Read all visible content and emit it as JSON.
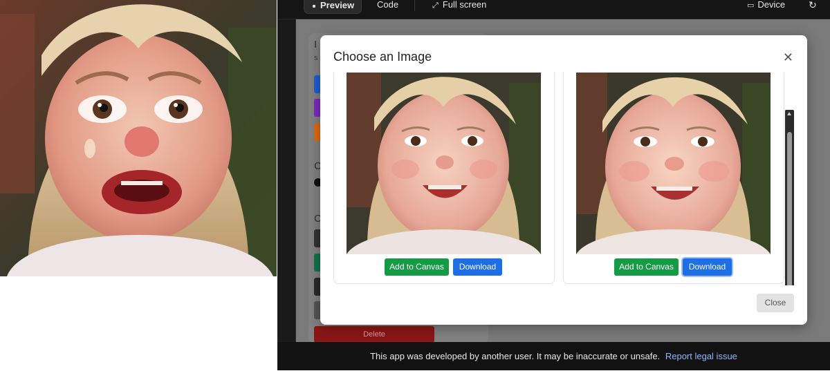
{
  "topbar": {
    "tabs": [
      {
        "label": "Preview",
        "active": true
      },
      {
        "label": "Code",
        "active": false
      },
      {
        "label": "Full screen",
        "icon": "expand-icon"
      }
    ],
    "device_label": "Device",
    "device_icon": "device-icon",
    "reload_icon": "refresh-icon"
  },
  "background": {
    "letters": [
      "I",
      "S",
      "C",
      "C"
    ],
    "chip_colors": [
      "#1e5fd6",
      "#7a2bc2",
      "#e06b14"
    ],
    "delete_label": "Delete"
  },
  "modal": {
    "title": "Choose an Image",
    "close_icon": "close-icon",
    "images": [
      {
        "add_label": "Add to Canvas",
        "download_label": "Download"
      },
      {
        "add_label": "Add to Canvas",
        "download_label": "Download"
      }
    ],
    "close_label": "Close"
  },
  "footer": {
    "text": "This app was developed by another user. It may be inaccurate or unsafe.",
    "link": "Report legal issue"
  },
  "colors": {
    "add_button": "#159a45",
    "download_button": "#1e6fe6",
    "footer_link": "#8fb6ff"
  }
}
